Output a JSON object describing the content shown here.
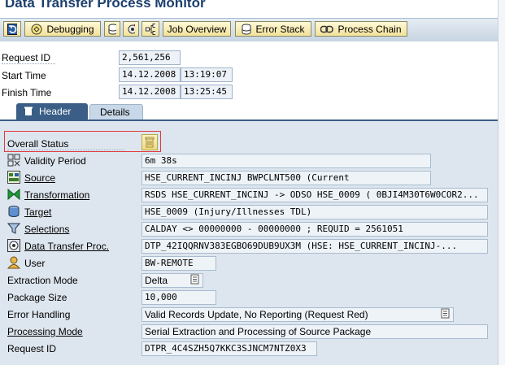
{
  "window": {
    "title": "Data Transfer Process Monitor"
  },
  "toolbar": {
    "debugging": "Debugging",
    "job_overview": "Job Overview",
    "error_stack": "Error Stack",
    "process_chain": "Process Chain"
  },
  "header": {
    "request_id_label": "Request ID",
    "request_id": "2,561,256",
    "start_time_label": "Start Time",
    "start_date": "14.12.2008",
    "start_time": "13:19:07",
    "finish_time_label": "Finish Time",
    "finish_date": "14.12.2008",
    "finish_time": "13:25:45"
  },
  "tabs": [
    {
      "label": "Header"
    },
    {
      "label": "Details"
    }
  ],
  "details": {
    "overall_status": "Overall Status",
    "rows": [
      {
        "label": "Validity Period",
        "value": "6m 38s"
      },
      {
        "label": "Source",
        "value": "HSE_CURRENT_INCINJ        BWPCLNT500 (Current"
      },
      {
        "label": "Transformation",
        "value": "RSDS HSE_CURRENT_INCINJ -> ODSO HSE_0009 ( 0BJI4M30T6W0COR2..."
      },
      {
        "label": "Target",
        "value": "HSE_0009 (Injury/Illnesses TDL)"
      },
      {
        "label": "Selections",
        "value": "CALDAY <> 00000000 - 00000000 ; REQUID = 2561051"
      },
      {
        "label": "Data Transfer Proc.",
        "value": "DTP_42IQQRNV383EGBO69DUB9UX3M (HSE: HSE_CURRENT_INCINJ-..."
      },
      {
        "label": "User",
        "value": "BW-REMOTE"
      },
      {
        "label": "Extraction Mode",
        "value": "Delta"
      },
      {
        "label": "Package Size",
        "value": "10,000"
      },
      {
        "label": "Error Handling",
        "value": "Valid Records Update, No Reporting (Request Red)"
      },
      {
        "label": "Processing Mode",
        "value": "Serial Extraction and Processing of Source Package"
      },
      {
        "label": "Request ID",
        "value": "DTPR_4C4SZH5Q7KKC3SJNCM7NTZ0X3"
      }
    ]
  },
  "colors": {
    "accent": "#3a5e86",
    "highlight_box": "#e0393e",
    "status_yellow": "#f2e29a"
  }
}
